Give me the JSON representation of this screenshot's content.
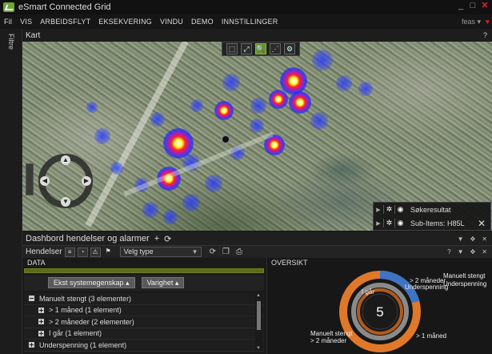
{
  "app": {
    "title": "eSmart Connected Grid",
    "user": "feas ▾"
  },
  "window_controls": {
    "minimize": "_",
    "maximize": "□",
    "close": "✕"
  },
  "menu": [
    "Fil",
    "VIS",
    "ARBEIDSFLYT",
    "EKSEKVERING",
    "VINDU",
    "DEMO",
    "INNSTILLINGER"
  ],
  "left_rail": {
    "label": "Filtre"
  },
  "map_panel": {
    "title": "Kart",
    "help": "?"
  },
  "map_tools": [
    "⬚",
    "⤢",
    "🔍",
    "⋰",
    "⚙"
  ],
  "result_box": {
    "rows": [
      {
        "label": "Søkeresultat",
        "icons": [
          "✲",
          "◉"
        ]
      },
      {
        "label": "Sub-Items: H85L",
        "icons": [
          "✲",
          "◉"
        ],
        "close": "✕"
      }
    ]
  },
  "dashboard": {
    "title": "Dashbord hendelser og alarmer",
    "add": "+",
    "refresh": "⟳",
    "controls": [
      "▼",
      "✥",
      "✕"
    ]
  },
  "events": {
    "title": "Hendelser",
    "type_select": {
      "value": "Velg type"
    },
    "controls": [
      "?",
      "▼",
      "✥",
      "✕"
    ]
  },
  "data_panel": {
    "header": "DATA",
    "group_chips": [
      "Ekst systemegenskap ▴",
      "Varighet ▴"
    ],
    "tree": [
      {
        "label": "Manuelt stengt (3 elementer)",
        "level": 0,
        "expanded": true
      },
      {
        "label": "> 1 måned (1 element)",
        "level": 1,
        "expanded": false
      },
      {
        "label": "> 2 måneder (2 elementer)",
        "level": 1,
        "expanded": false
      },
      {
        "label": "I går (1 element)",
        "level": 1,
        "expanded": false
      },
      {
        "label": "Underspenning (1 element)",
        "level": 0,
        "expanded": false
      }
    ]
  },
  "overview_panel": {
    "header": "OVERSIKT",
    "center_value": "5",
    "labels": {
      "top_right_1": "> 2 måneder",
      "top_right_2": "Underspenning",
      "far_right_1": "Manuelt stengt",
      "far_right_2": "Underspenning",
      "top_left": "I går",
      "bottom_left_1": "Manuelt stengt",
      "bottom_left_2": "> 2 måneder",
      "bottom_right": "> 1 måned"
    },
    "colors": {
      "outer_orange": "#e0782a",
      "outer_blue": "#3f73c4",
      "inner_ring": "#8a8a8a",
      "core": "#1a1a1a"
    }
  }
}
